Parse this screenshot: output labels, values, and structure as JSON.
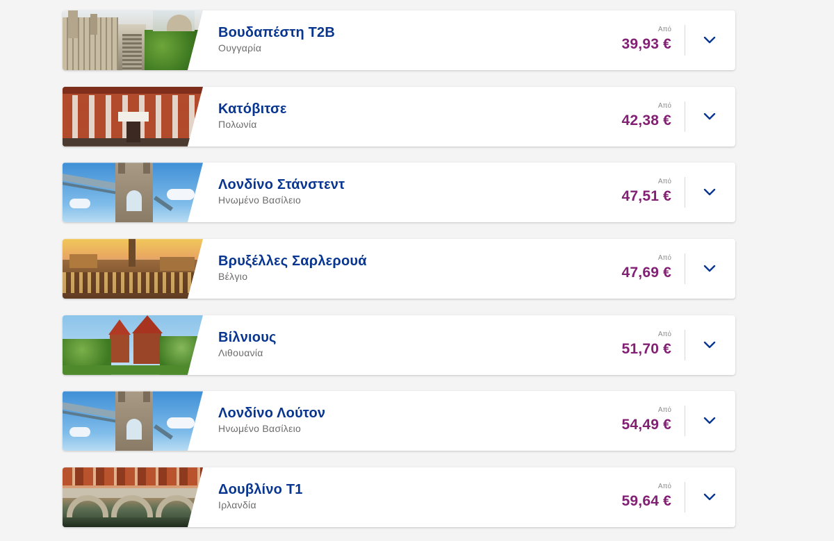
{
  "colors": {
    "city": "#073590",
    "price": "#822074",
    "chevron": "#073590"
  },
  "destinations": [
    {
      "city": "Βουδαπέστη T2B",
      "country": "Ουγγαρία",
      "from_label": "Από",
      "price": "39,93 €",
      "image": "budapest-fishermans-bastion"
    },
    {
      "city": "Κατόβιτσε",
      "country": "Πολωνία",
      "from_label": "Από",
      "price": "42,38 €",
      "image": "katowice-red-brick-building"
    },
    {
      "city": "Λονδίνο Στάνστεντ",
      "country": "Ηνωμένο Βασίλειο",
      "from_label": "Από",
      "price": "47,51 €",
      "image": "london-tower-bridge"
    },
    {
      "city": "Βρυξέλλες Σαρλερουά",
      "country": "Βέλγιο",
      "from_label": "Από",
      "price": "47,69 €",
      "image": "brussels-grand-place"
    },
    {
      "city": "Βίλνιους",
      "country": "Λιθουανία",
      "from_label": "Από",
      "price": "51,70 €",
      "image": "trakai-castle"
    },
    {
      "city": "Λονδίνο Λούτον",
      "country": "Ηνωμένο Βασίλειο",
      "from_label": "Από",
      "price": "54,49 €",
      "image": "london-tower-bridge"
    },
    {
      "city": "Δουβλίνο T1",
      "country": "Ιρλανδία",
      "from_label": "Από",
      "price": "59,64 €",
      "image": "dublin-stone-bridge"
    }
  ]
}
